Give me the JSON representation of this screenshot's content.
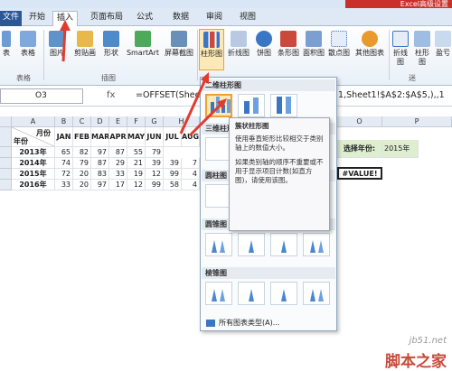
{
  "title_bar": {
    "text": "Excel高级设置"
  },
  "tabs": [
    {
      "label": "开始",
      "active": false
    },
    {
      "label": "插入",
      "active": true
    },
    {
      "label": "页面布局",
      "active": false
    },
    {
      "label": "公式",
      "active": false
    },
    {
      "label": "数据",
      "active": false
    },
    {
      "label": "审阅",
      "active": false
    },
    {
      "label": "视图",
      "active": false
    }
  ],
  "ribbon": {
    "buttons": [
      {
        "label": "表格"
      },
      {
        "label": "图片"
      },
      {
        "label": "剪贴画"
      },
      {
        "label": "形状"
      },
      {
        "label": "SmartArt"
      },
      {
        "label": "屏幕截图"
      },
      {
        "label": "柱形图"
      },
      {
        "label": "折线图"
      },
      {
        "label": "饼图"
      },
      {
        "label": "条形图"
      },
      {
        "label": "面积图"
      },
      {
        "label": "散点图"
      },
      {
        "label": "其他图表"
      },
      {
        "label": "折线图"
      },
      {
        "label": "柱形图"
      },
      {
        "label": "盈亏"
      }
    ],
    "groups": {
      "table": "表格",
      "illustrations": "插图",
      "sparklines": "迷"
    },
    "fragment": "表"
  },
  "formula_bar": {
    "name_box": "O3",
    "formula": "=OFFSET(Sheet",
    "formula_tail": "1,Sheet1!$A$2:$A$5,),,1"
  },
  "sheet": {
    "columns": [
      "A",
      "B",
      "C",
      "D",
      "E",
      "F",
      "G",
      "H",
      "O",
      "P"
    ],
    "row_numbers": [
      "1",
      "2",
      "3",
      "4",
      "5"
    ],
    "header_corner": {
      "top": "月份",
      "bottom": "年份"
    },
    "months": [
      "JAN",
      "FEB",
      "MAR",
      "APR",
      "MAY",
      "JUN",
      "JUL",
      "AUG"
    ],
    "rows": [
      {
        "year": "2013年",
        "values": [
          "65",
          "82",
          "97",
          "87",
          "55",
          "79",
          ""
        ]
      },
      {
        "year": "2014年",
        "values": [
          "74",
          "79",
          "87",
          "29",
          "21",
          "39",
          "39",
          "7"
        ]
      },
      {
        "year": "2015年",
        "values": [
          "72",
          "20",
          "83",
          "33",
          "19",
          "12",
          "99",
          "4"
        ]
      },
      {
        "year": "2016年",
        "values": [
          "33",
          "20",
          "97",
          "17",
          "12",
          "99",
          "58",
          "4"
        ]
      }
    ],
    "select_year_label": "选择年份:",
    "select_year_value": "2015年",
    "error_value": "#VALUE!"
  },
  "dropdown": {
    "sections": [
      "二维柱形图",
      "三维柱形图",
      "圆柱图",
      "圆锥图",
      "棱锥图"
    ],
    "all_charts": "所有图表类型(A)..."
  },
  "tooltip": {
    "title": "簇状柱形图",
    "p1": "使用垂直矩形比较相交于类别轴上的数值大小。",
    "p2": "如果类别轴的顺序不重要或不用于显示项目计数(如直方图)，请使用该图。"
  },
  "watermark": {
    "line1": "jb51.net",
    "line2": "脚本之家"
  }
}
